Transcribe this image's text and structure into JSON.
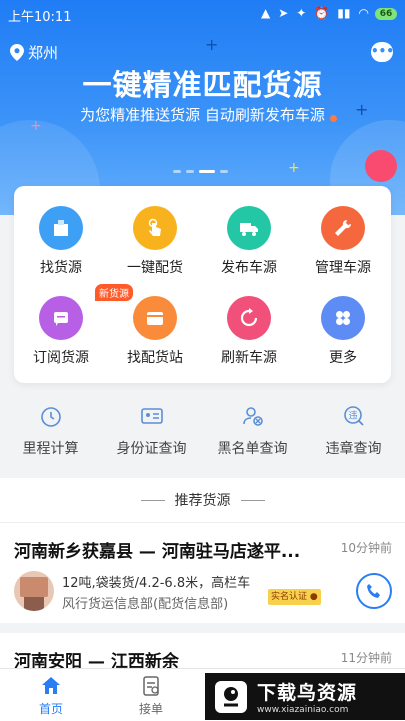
{
  "status_bar": {
    "time": "上午10:11",
    "battery": "66"
  },
  "header": {
    "location": "郑州"
  },
  "banner": {
    "title": "一键精准匹配货源",
    "subtitle": "为您精准推送货源 自动刷新发布车源"
  },
  "grid": [
    {
      "label": "找货源",
      "icon": "cargo-box-icon",
      "color": "#3da0f5"
    },
    {
      "label": "一键配货",
      "icon": "tap-hand-icon",
      "color": "#f7b21e"
    },
    {
      "label": "发布车源",
      "icon": "truck-icon",
      "color": "#24c7a5"
    },
    {
      "label": "管理车源",
      "icon": "wrench-icon",
      "color": "#f5683e"
    },
    {
      "label": "订阅货源",
      "icon": "subscribe-icon",
      "color": "#b760e6",
      "badge": "新货源"
    },
    {
      "label": "找配货站",
      "icon": "wallet-icon",
      "color": "#f98b3a"
    },
    {
      "label": "刷新车源",
      "icon": "refresh-icon",
      "color": "#f0507a"
    },
    {
      "label": "更多",
      "icon": "more-grid-icon",
      "color": "#5d8cf4"
    }
  ],
  "tools": [
    {
      "label": "里程计算",
      "icon": "stopwatch-icon"
    },
    {
      "label": "身份证查询",
      "icon": "id-card-icon"
    },
    {
      "label": "黑名单查询",
      "icon": "blacklist-user-icon"
    },
    {
      "label": "违章查询",
      "icon": "violation-search-icon"
    }
  ],
  "recommend": {
    "title": "推荐货源"
  },
  "cargos": [
    {
      "route": "河南新乡获嘉县 — 河南驻马店遂平...",
      "time_ago": "10分钟前",
      "detail": "12吨,袋装货/4.2-6.8米，高栏车",
      "company": "风行货运信息部(配货信息部)",
      "cert": "实名认证"
    },
    {
      "route": "河南安阳 — 江西新余",
      "time_ago": "11分钟前"
    }
  ],
  "tabbar": [
    {
      "label": "首页",
      "icon": "home-icon",
      "active": true
    },
    {
      "label": "接单",
      "icon": "order-icon",
      "active": false
    }
  ],
  "watermark": {
    "name": "下载鸟资源",
    "url": "www.xiazainiao.com"
  }
}
